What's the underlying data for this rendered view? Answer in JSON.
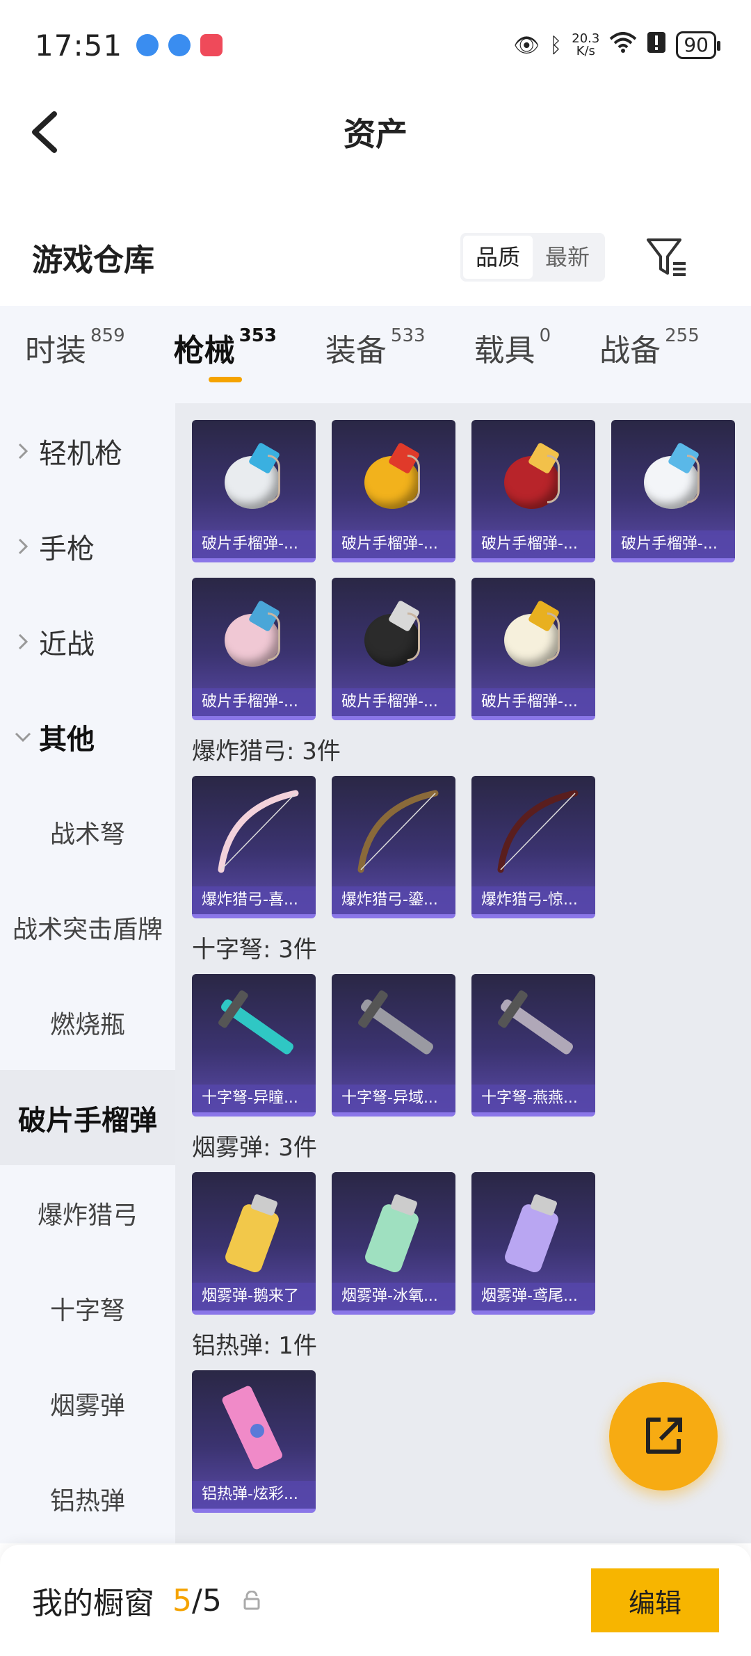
{
  "status_bar": {
    "time": "17:51",
    "net_speed_top": "20.3",
    "net_speed_bottom": "K/s",
    "battery": "90"
  },
  "header": {
    "title": "资产"
  },
  "warehouse": {
    "title": "游戏仓库",
    "sort": {
      "quality": "品质",
      "latest": "最新"
    }
  },
  "tabs": [
    {
      "label": "时装",
      "count": "859"
    },
    {
      "label": "枪械",
      "count": "353"
    },
    {
      "label": "装备",
      "count": "533"
    },
    {
      "label": "载具",
      "count": "0"
    },
    {
      "label": "战备",
      "count": "255"
    }
  ],
  "sidebar": [
    {
      "label": "轻机枪"
    },
    {
      "label": "手枪"
    },
    {
      "label": "近战"
    },
    {
      "label": "其他"
    },
    {
      "label": "战术弩"
    },
    {
      "label": "战术突击盾牌"
    },
    {
      "label": "燃烧瓶"
    },
    {
      "label": "破片手榴弹"
    },
    {
      "label": "爆炸猎弓"
    },
    {
      "label": "十字弩"
    },
    {
      "label": "烟雾弹"
    },
    {
      "label": "铝热弹"
    }
  ],
  "groups": {
    "frag": {
      "items": [
        {
          "label": "破片手榴弹-...",
          "color": "#e9ecef",
          "accent": "#3ab0e0"
        },
        {
          "label": "破片手榴弹-...",
          "color": "#f2b21c",
          "accent": "#e03a2a"
        },
        {
          "label": "破片手榴弹-...",
          "color": "#b8242a",
          "accent": "#f2c14a"
        },
        {
          "label": "破片手榴弹-...",
          "color": "#f3f5f8",
          "accent": "#5ab8e8"
        },
        {
          "label": "破片手榴弹-...",
          "color": "#f0c8d4",
          "accent": "#4aa6d8"
        },
        {
          "label": "破片手榴弹-...",
          "color": "#2b2b2b",
          "accent": "#d8d8d8"
        },
        {
          "label": "破片手榴弹-...",
          "color": "#f6f0dc",
          "accent": "#e8b020"
        }
      ]
    },
    "bow": {
      "title": "爆炸猎弓: 3件",
      "items": [
        {
          "label": "爆炸猎弓-喜...",
          "color": "#f3d2db"
        },
        {
          "label": "爆炸猎弓-鎏...",
          "color": "#8a6a3a"
        },
        {
          "label": "爆炸猎弓-惊...",
          "color": "#5a1e1e"
        }
      ]
    },
    "crossbow": {
      "title": "十字弩: 3件",
      "items": [
        {
          "label": "十字弩-异瞳...",
          "color": "#2fc7c4"
        },
        {
          "label": "十字弩-异域...",
          "color": "#9a9aa2"
        },
        {
          "label": "十字弩-燕燕...",
          "color": "#b0a8b8"
        }
      ]
    },
    "smoke": {
      "title": "烟雾弹: 3件",
      "items": [
        {
          "label": "烟雾弹-鹅来了",
          "color": "#f2c84a"
        },
        {
          "label": "烟雾弹-冰氧...",
          "color": "#9fe0c0"
        },
        {
          "label": "烟雾弹-鸢尾...",
          "color": "#b9a6f2"
        }
      ]
    },
    "thermite": {
      "title": "铝热弹: 1件",
      "items": [
        {
          "label": "铝热弹-炫彩...",
          "color": "#f08ac8"
        }
      ]
    }
  },
  "bottom_bar": {
    "title": "我的橱窗",
    "current": "5",
    "total": "/5",
    "edit": "编辑"
  }
}
